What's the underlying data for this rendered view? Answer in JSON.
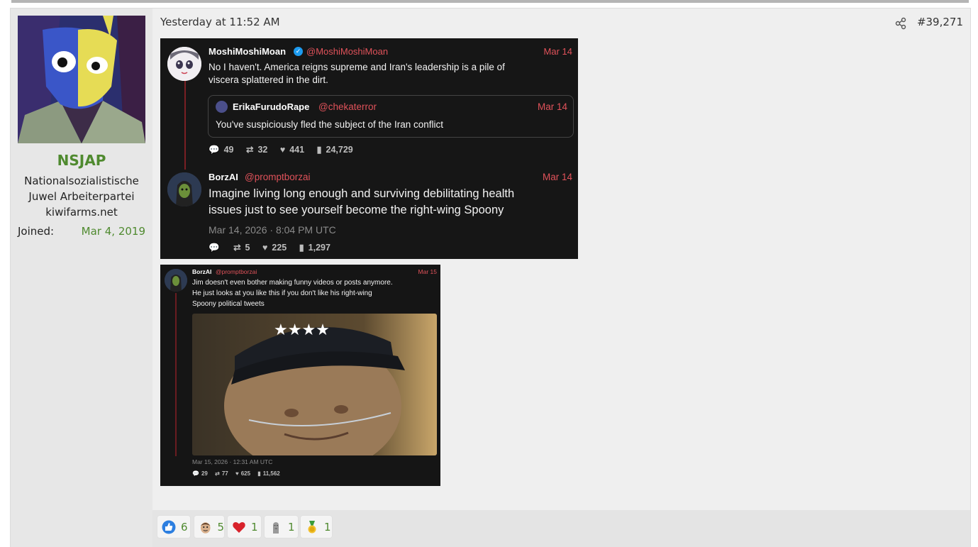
{
  "user": {
    "name": "NSJAP",
    "title": "Nationalsozialistische Juwel Arbeiterpartei",
    "site": "kiwifarms.net",
    "joined_label": "Joined:",
    "joined_value": "Mar 4, 2019"
  },
  "post": {
    "date": "Yesterday at 11:52 AM",
    "number": "#39,271",
    "share_icon": "share-icon"
  },
  "image1": {
    "tweet1": {
      "name": "MoshiMoshiMoan",
      "handle": "@MoshiMoshiMoan",
      "date": "Mar 14",
      "text_line1": "No I haven't.  America reigns supreme and Iran's leadership is a pile of",
      "text_line2": "viscera splattered in the dirt.",
      "replies": "49",
      "retweets": "32",
      "likes": "441",
      "views": "24,729"
    },
    "quote": {
      "name": "ErikaFurudoRape",
      "handle": "@chekaterror",
      "date": "Mar 14",
      "text": "You've suspiciously fled the subject of the Iran conflict"
    },
    "tweet2": {
      "name": "BorzAI",
      "handle": "@promptborzai",
      "date": "Mar 14",
      "text_line1": "Imagine living long enough and surviving debilitating health",
      "text_line2": "issues just to see yourself become the right-wing Spoony",
      "timestamp": "Mar 14, 2026 · 8:04 PM UTC",
      "retweets": "5",
      "likes": "225",
      "views": "1,297"
    }
  },
  "image2": {
    "name": "BorzAI",
    "handle": "@promptborzai",
    "date": "Mar 15",
    "text_line1": "Jim doesn't even bother making funny videos or posts anymore.",
    "text_line2": "He just looks at you like this if you don't like his right-wing",
    "text_line3": "Spoony political tweets",
    "timestamp": "Mar 15, 2026 · 12:31 AM UTC",
    "replies": "29",
    "retweets": "77",
    "likes": "625",
    "views": "11,562"
  },
  "reactions": [
    {
      "icon": "thumbs-up-icon",
      "count": "6"
    },
    {
      "icon": "face-icon",
      "count": "5"
    },
    {
      "icon": "heart-icon",
      "count": "1"
    },
    {
      "icon": "statue-icon",
      "count": "1"
    },
    {
      "icon": "medal-icon",
      "count": "1"
    }
  ]
}
